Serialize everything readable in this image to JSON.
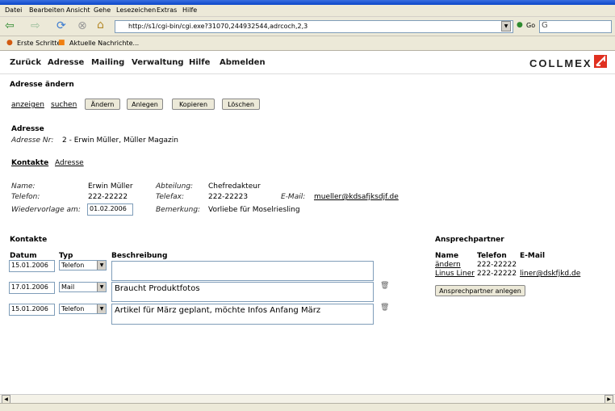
{
  "browser": {
    "menu": [
      "Datei",
      "Bearbeiten",
      "Ansicht",
      "Gehe",
      "Lesezeichen",
      "Extras",
      "Hilfe"
    ],
    "url": "http://s1/cgi-bin/cgi.exe?31070,244932544,adrcoch,2,3",
    "go_label": "Go",
    "bookmarks": [
      "Erste Schritte",
      "Aktuelle Nachrichte..."
    ]
  },
  "appnav": {
    "items": [
      "Zurück",
      "Adresse",
      "Mailing",
      "Verwaltung",
      "Hilfe",
      "Abmelden"
    ],
    "logo": "COLLMEX"
  },
  "page": {
    "title": "Adresse ändern",
    "links": [
      "anzeigen",
      "suchen"
    ],
    "buttons": [
      "Ändern",
      "Anlegen",
      "Kopieren",
      "Löschen"
    ],
    "address_heading": "Adresse",
    "address_nr_label": "Adresse Nr:",
    "address_nr_value": "2 - Erwin Müller, Müller Magazin",
    "tabs": [
      "Kontakte",
      "Adresse"
    ]
  },
  "details": {
    "name_label": "Name:",
    "name_value": "Erwin Müller",
    "abteilung_label": "Abteilung:",
    "abteilung_value": "Chefredakteur",
    "telefon_label": "Telefon:",
    "telefon_value": "222-22222",
    "telefax_label": "Telefax:",
    "telefax_value": "222-22223",
    "email_label": "E-Mail:",
    "email_value": "mueller@kdsafjksdjf.de",
    "wiedervorlage_label": "Wiedervorlage am:",
    "wiedervorlage_value": "01.02.2006",
    "bemerkung_label": "Bemerkung:",
    "bemerkung_value": "Vorliebe für Moselriesling"
  },
  "kontakte": {
    "heading": "Kontakte",
    "headers": [
      "Datum",
      "Typ",
      "Beschreibung"
    ],
    "rows": [
      {
        "datum": "15.01.2006",
        "typ": "Telefon",
        "beschreibung": ""
      },
      {
        "datum": "17.01.2006",
        "typ": "Mail",
        "beschreibung": "Braucht Produktfotos"
      },
      {
        "datum": "15.01.2006",
        "typ": "Telefon",
        "beschreibung": "Artikel für März geplant, möchte Infos Anfang März"
      }
    ]
  },
  "ansprechpartner": {
    "heading": "Ansprechpartner",
    "headers": [
      "Name",
      "Telefon",
      "E-Mail"
    ],
    "rows": [
      {
        "name": "ändern",
        "telefon": "222-22222",
        "email": ""
      },
      {
        "name": "Linus Liner",
        "telefon": "222-22222",
        "email": "liner@dskfjkd.de"
      }
    ],
    "button": "Ansprechpartner anlegen"
  },
  "colors": {
    "logo_accent": "#e03020",
    "titlebar": "#0b46c8",
    "chrome": "#ece9d8"
  }
}
